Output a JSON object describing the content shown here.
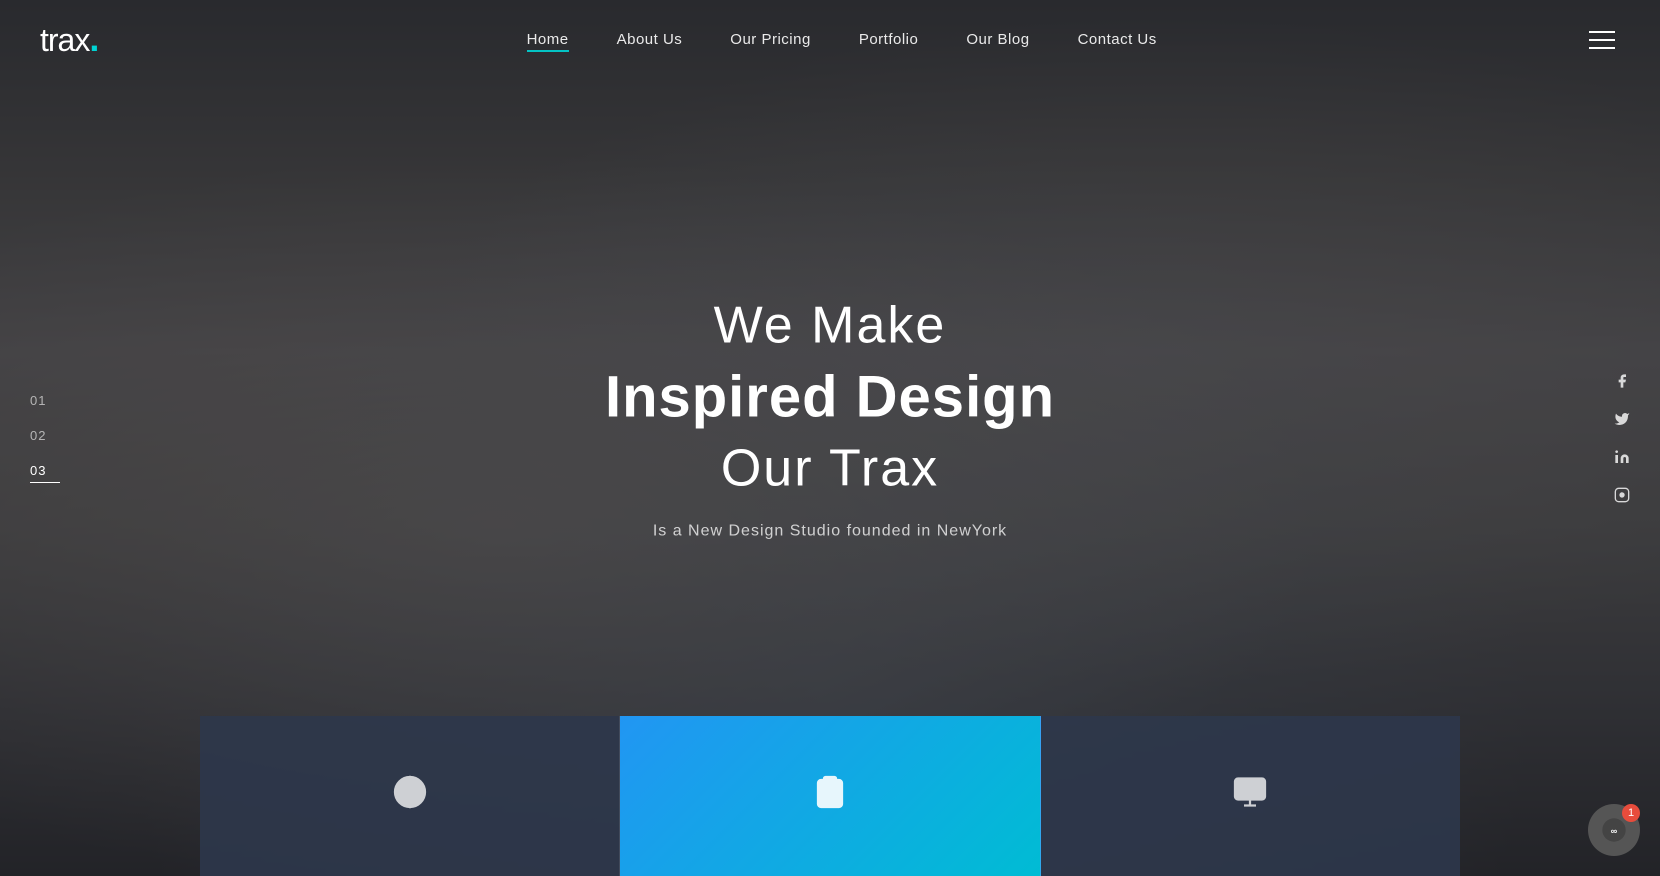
{
  "logo": {
    "text": "trax",
    "dot": "."
  },
  "nav": {
    "links": [
      {
        "label": "Home",
        "active": true
      },
      {
        "label": "About Us",
        "active": false
      },
      {
        "label": "Our Pricing",
        "active": false
      },
      {
        "label": "Portfolio",
        "active": false
      },
      {
        "label": "Our Blog",
        "active": false
      },
      {
        "label": "Contact Us",
        "active": false
      }
    ]
  },
  "hero": {
    "line1": "We Make",
    "line2": "Inspired Design",
    "line3": "Our Trax",
    "subtitle": "Is a New Design Studio founded in NewYork"
  },
  "slides": [
    {
      "num": "01",
      "active": false
    },
    {
      "num": "02",
      "active": false
    },
    {
      "num": "03",
      "active": true
    }
  ],
  "social": [
    {
      "name": "facebook",
      "symbol": "f"
    },
    {
      "name": "twitter",
      "symbol": "t"
    },
    {
      "name": "linkedin",
      "symbol": "in"
    },
    {
      "name": "instagram",
      "symbol": "ig"
    }
  ],
  "bottom_cards": [
    {
      "icon": "globe",
      "active": false
    },
    {
      "icon": "clipboard",
      "active": true
    },
    {
      "icon": "monitor",
      "active": false
    }
  ],
  "notification": {
    "count": "1"
  }
}
